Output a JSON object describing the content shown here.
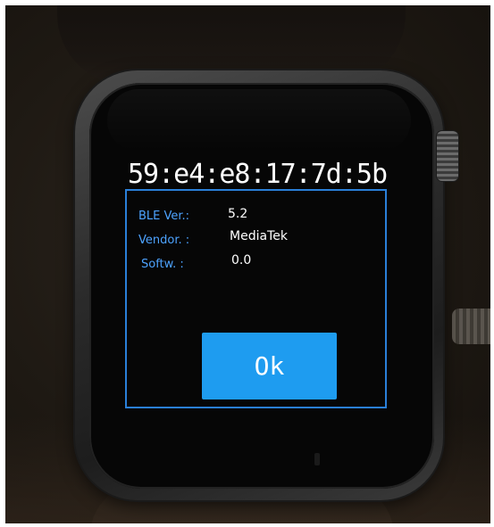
{
  "screen": {
    "device_address": "59:e4:e8:17:7d:5b",
    "info": [
      {
        "label": "BLE Ver.:",
        "value": "5.2"
      },
      {
        "label": "Vendor. :",
        "value": "MediaTek"
      },
      {
        "label": "Softw.  :",
        "value": "0.0"
      }
    ],
    "ok_label": "Ok"
  },
  "colors": {
    "accent": "#2a7fd8",
    "button": "#1e9cf0",
    "label_text": "#4da3ff",
    "value_text": "#ffffff",
    "screen_bg": "#060606"
  },
  "icons": {
    "crown": "watch-crown-icon"
  }
}
